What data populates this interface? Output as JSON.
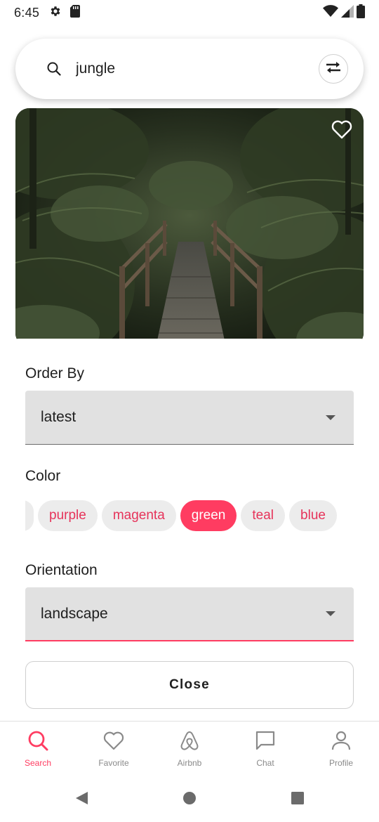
{
  "status_bar": {
    "time": "6:45",
    "left_icons": [
      "gear-icon",
      "sd-card-icon"
    ],
    "right_icons": [
      "wifi-icon",
      "signal-icon",
      "battery-icon"
    ]
  },
  "search": {
    "query": "jungle",
    "icon": "search-icon",
    "filter_icon": "filter-toggle-icon"
  },
  "photo_card": {
    "favorite_icon": "heart-outline-icon"
  },
  "filters": {
    "order_by": {
      "label": "Order By",
      "selected": "latest"
    },
    "color": {
      "label": "Color",
      "chips": [
        {
          "label": "purple",
          "selected": false
        },
        {
          "label": "magenta",
          "selected": false
        },
        {
          "label": "green",
          "selected": true
        },
        {
          "label": "teal",
          "selected": false
        },
        {
          "label": "blue",
          "selected": false
        }
      ]
    },
    "orientation": {
      "label": "Orientation",
      "selected": "landscape"
    },
    "close_label": "Close"
  },
  "bottom_nav": {
    "items": [
      {
        "label": "Search",
        "icon": "search-icon",
        "active": true
      },
      {
        "label": "Favorite",
        "icon": "heart-icon",
        "active": false
      },
      {
        "label": "Airbnb",
        "icon": "airbnb-logo-icon",
        "active": false
      },
      {
        "label": "Chat",
        "icon": "chat-icon",
        "active": false
      },
      {
        "label": "Profile",
        "icon": "person-icon",
        "active": false
      }
    ]
  },
  "colors": {
    "accent": "#ff3c61",
    "chip_text": "#e6335a",
    "chip_bg": "#ececec",
    "dropdown_bg": "#e1e1e1"
  }
}
